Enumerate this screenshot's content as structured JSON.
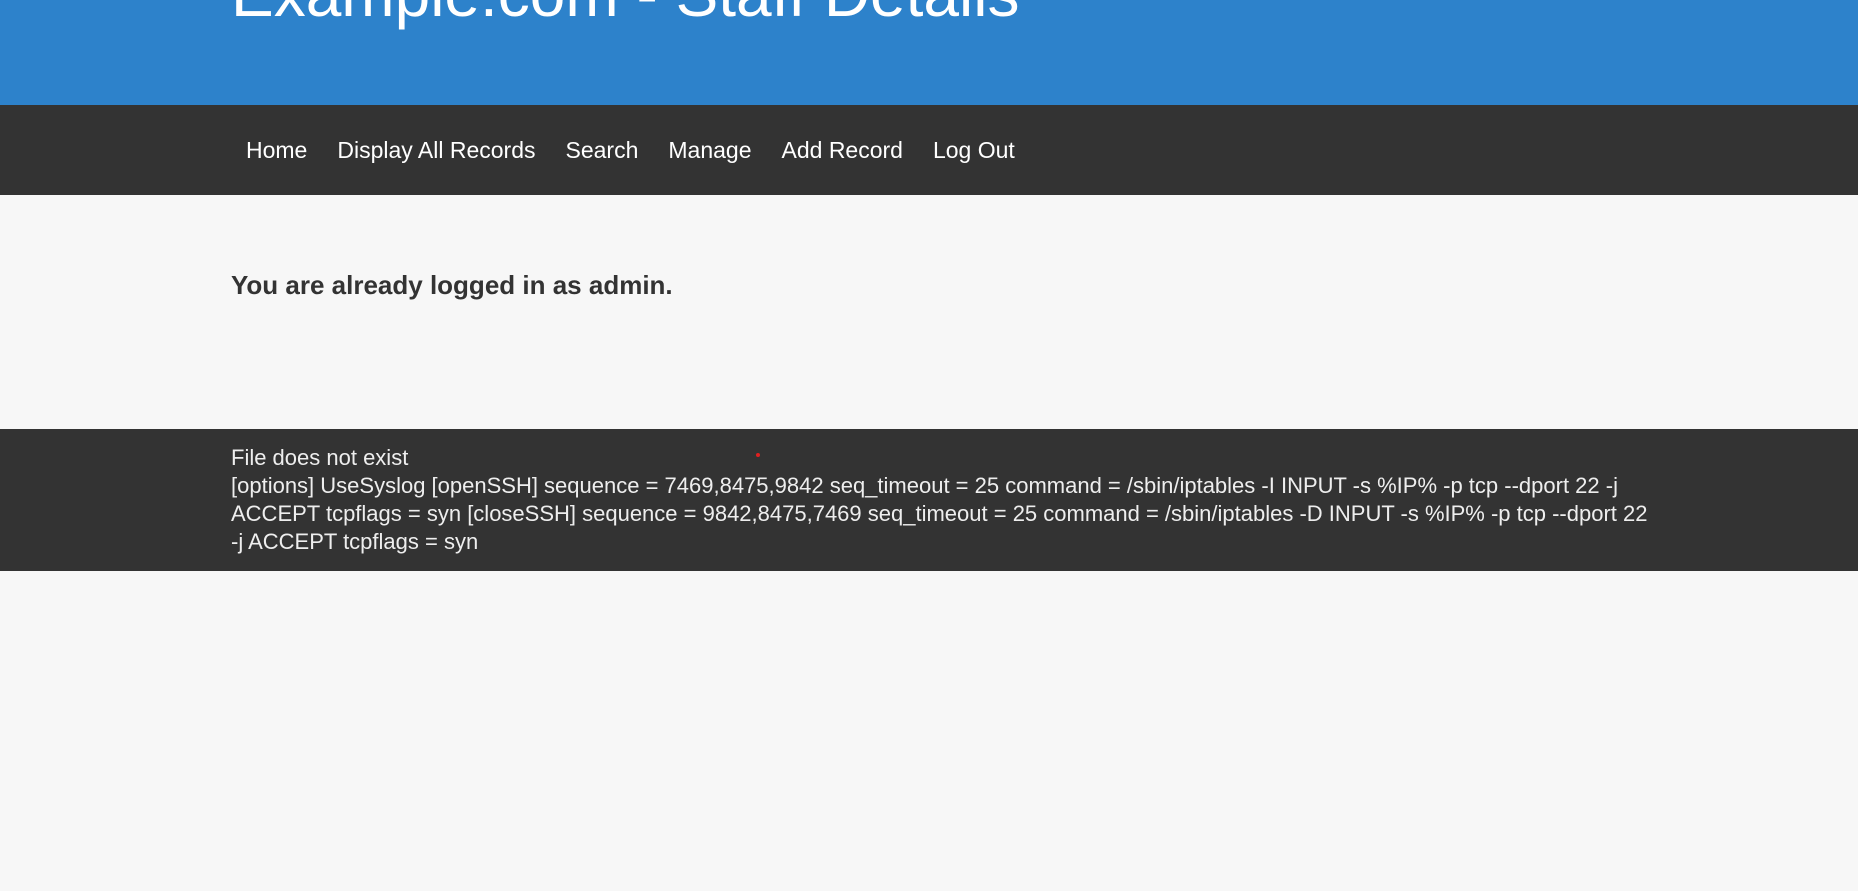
{
  "header": {
    "title": "Example.com - Staff Details"
  },
  "nav": {
    "items": [
      {
        "label": "Home"
      },
      {
        "label": "Display All Records"
      },
      {
        "label": "Search"
      },
      {
        "label": "Manage"
      },
      {
        "label": "Add Record"
      },
      {
        "label": "Log Out"
      }
    ]
  },
  "main": {
    "message": "You are already logged in as admin."
  },
  "footer": {
    "line1": "File does not exist",
    "config": "[options] UseSyslog [openSSH] sequence = 7469,8475,9842 seq_timeout = 25 command = /sbin/iptables -I INPUT -s %IP% -p tcp --dport 22 -j ACCEPT tcpflags = syn [closeSSH] sequence = 9842,8475,7469 seq_timeout = 25 command = /sbin/iptables -D INPUT -s %IP% -p tcp --dport 22 -j ACCEPT tcpflags = syn"
  },
  "colors": {
    "header_bg": "#2d82cb",
    "nav_bg": "#333333",
    "page_bg": "#f7f7f7"
  }
}
